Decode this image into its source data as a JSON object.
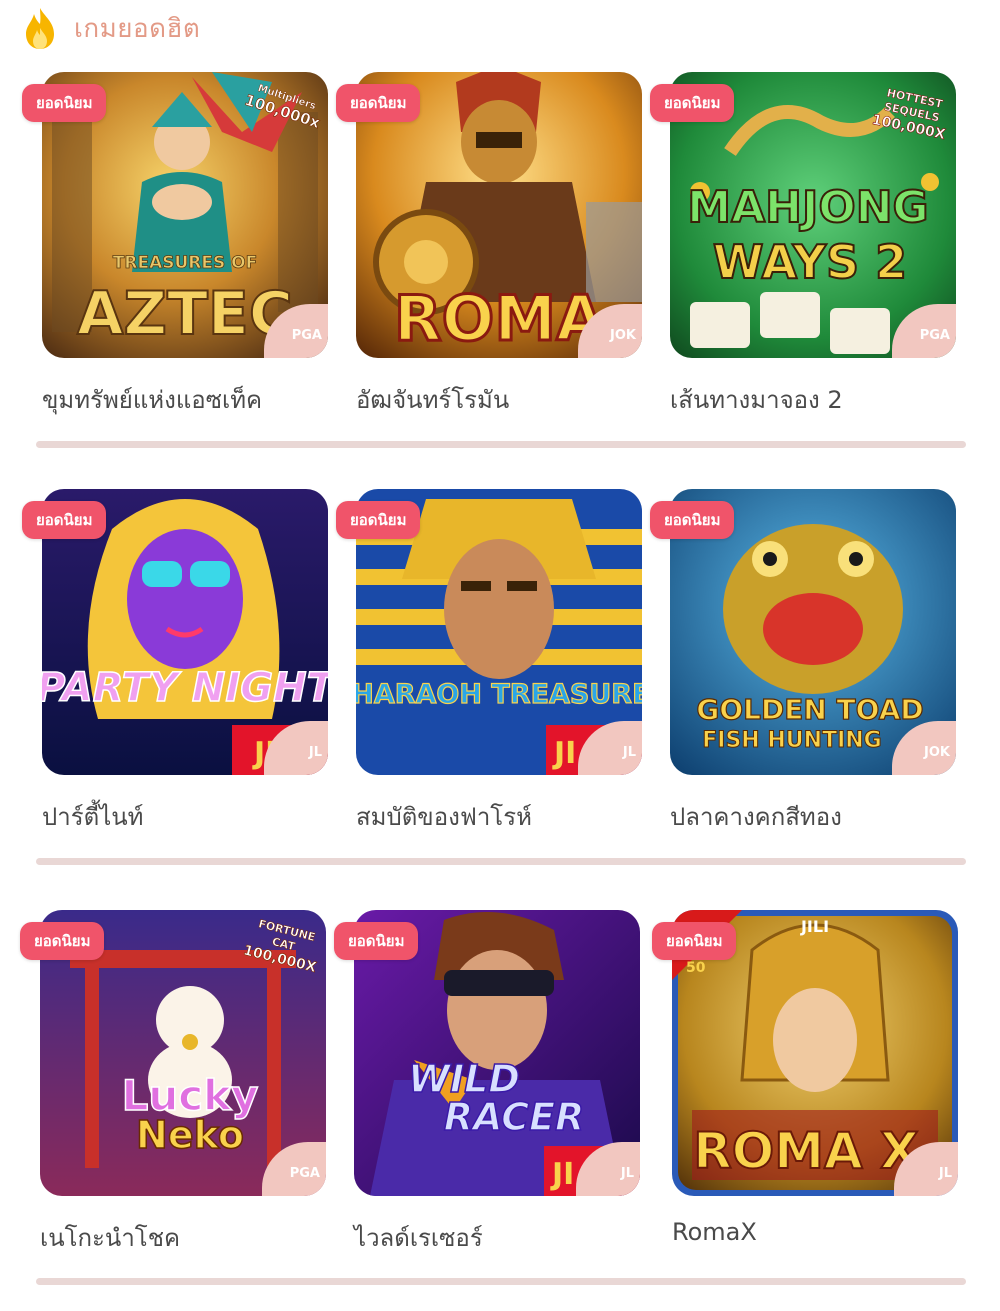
{
  "section": {
    "title": "เกมยอดฮิต",
    "icon": "fire-icon"
  },
  "colors": {
    "accent": "#e39a86",
    "badge": "#f0546a",
    "provider_tab": "#f2c7c0",
    "divider": "#e9d7d5"
  },
  "rows": [
    {
      "games": [
        {
          "badge": "ยอดนิยม",
          "title": "ขุมทรัพย์แห่งแอซเท็ค",
          "provider": "PGA",
          "art_text": [
            "TREASURES OF",
            "AZTEC"
          ],
          "art_extra": [
            "Multipliers",
            "100,000x"
          ]
        },
        {
          "badge": "ยอดนิยม",
          "title": "อัฒจันทร์โรมัน",
          "provider": "JOK",
          "art_text": [
            "ROMA"
          ],
          "art_extra": []
        },
        {
          "badge": "ยอดนิยม",
          "title": "เส้นทางมาจอง 2",
          "provider": "PGA",
          "art_text": [
            "MAHJONG",
            "WAYS 2"
          ],
          "art_extra": [
            "HOTTEST",
            "SEQUELS",
            "100,000X"
          ]
        }
      ]
    },
    {
      "games": [
        {
          "badge": "ยอดนิยม",
          "title": "ปาร์ตี้ไนท์",
          "provider": "JL",
          "art_text": [
            "PARTY NIGHT"
          ],
          "art_extra": [
            "JI"
          ]
        },
        {
          "badge": "ยอดนิยม",
          "title": "สมบัติของฟาโรห์",
          "provider": "JL",
          "art_text": [
            "PHARAOH TREASURE"
          ],
          "art_extra": [
            "JI"
          ]
        },
        {
          "badge": "ยอดนิยม",
          "title": "ปลาคางคกสีทอง",
          "provider": "JOK",
          "art_text": [
            "GOLDEN TOAD",
            "FISH HUNTING"
          ],
          "art_extra": []
        }
      ]
    },
    {
      "games": [
        {
          "badge": "ยอดนิยม",
          "title": "เนโกะนำโชค",
          "provider": "PGA",
          "art_text": [
            "Lucky",
            "Neko"
          ],
          "art_extra": [
            "FORTUNE",
            "CAT",
            "100,000X"
          ]
        },
        {
          "badge": "ยอดนิยม",
          "title": "ไวลด์เรเซอร์",
          "provider": "JL",
          "art_text": [
            "WILD",
            "RACER"
          ],
          "art_extra": [
            "JI"
          ]
        },
        {
          "badge": "ยอดนิยม",
          "title": "RomaX",
          "provider": "JL",
          "art_text": [
            "ROMA X"
          ],
          "art_extra": [
            "JILI",
            "50"
          ]
        }
      ]
    }
  ]
}
